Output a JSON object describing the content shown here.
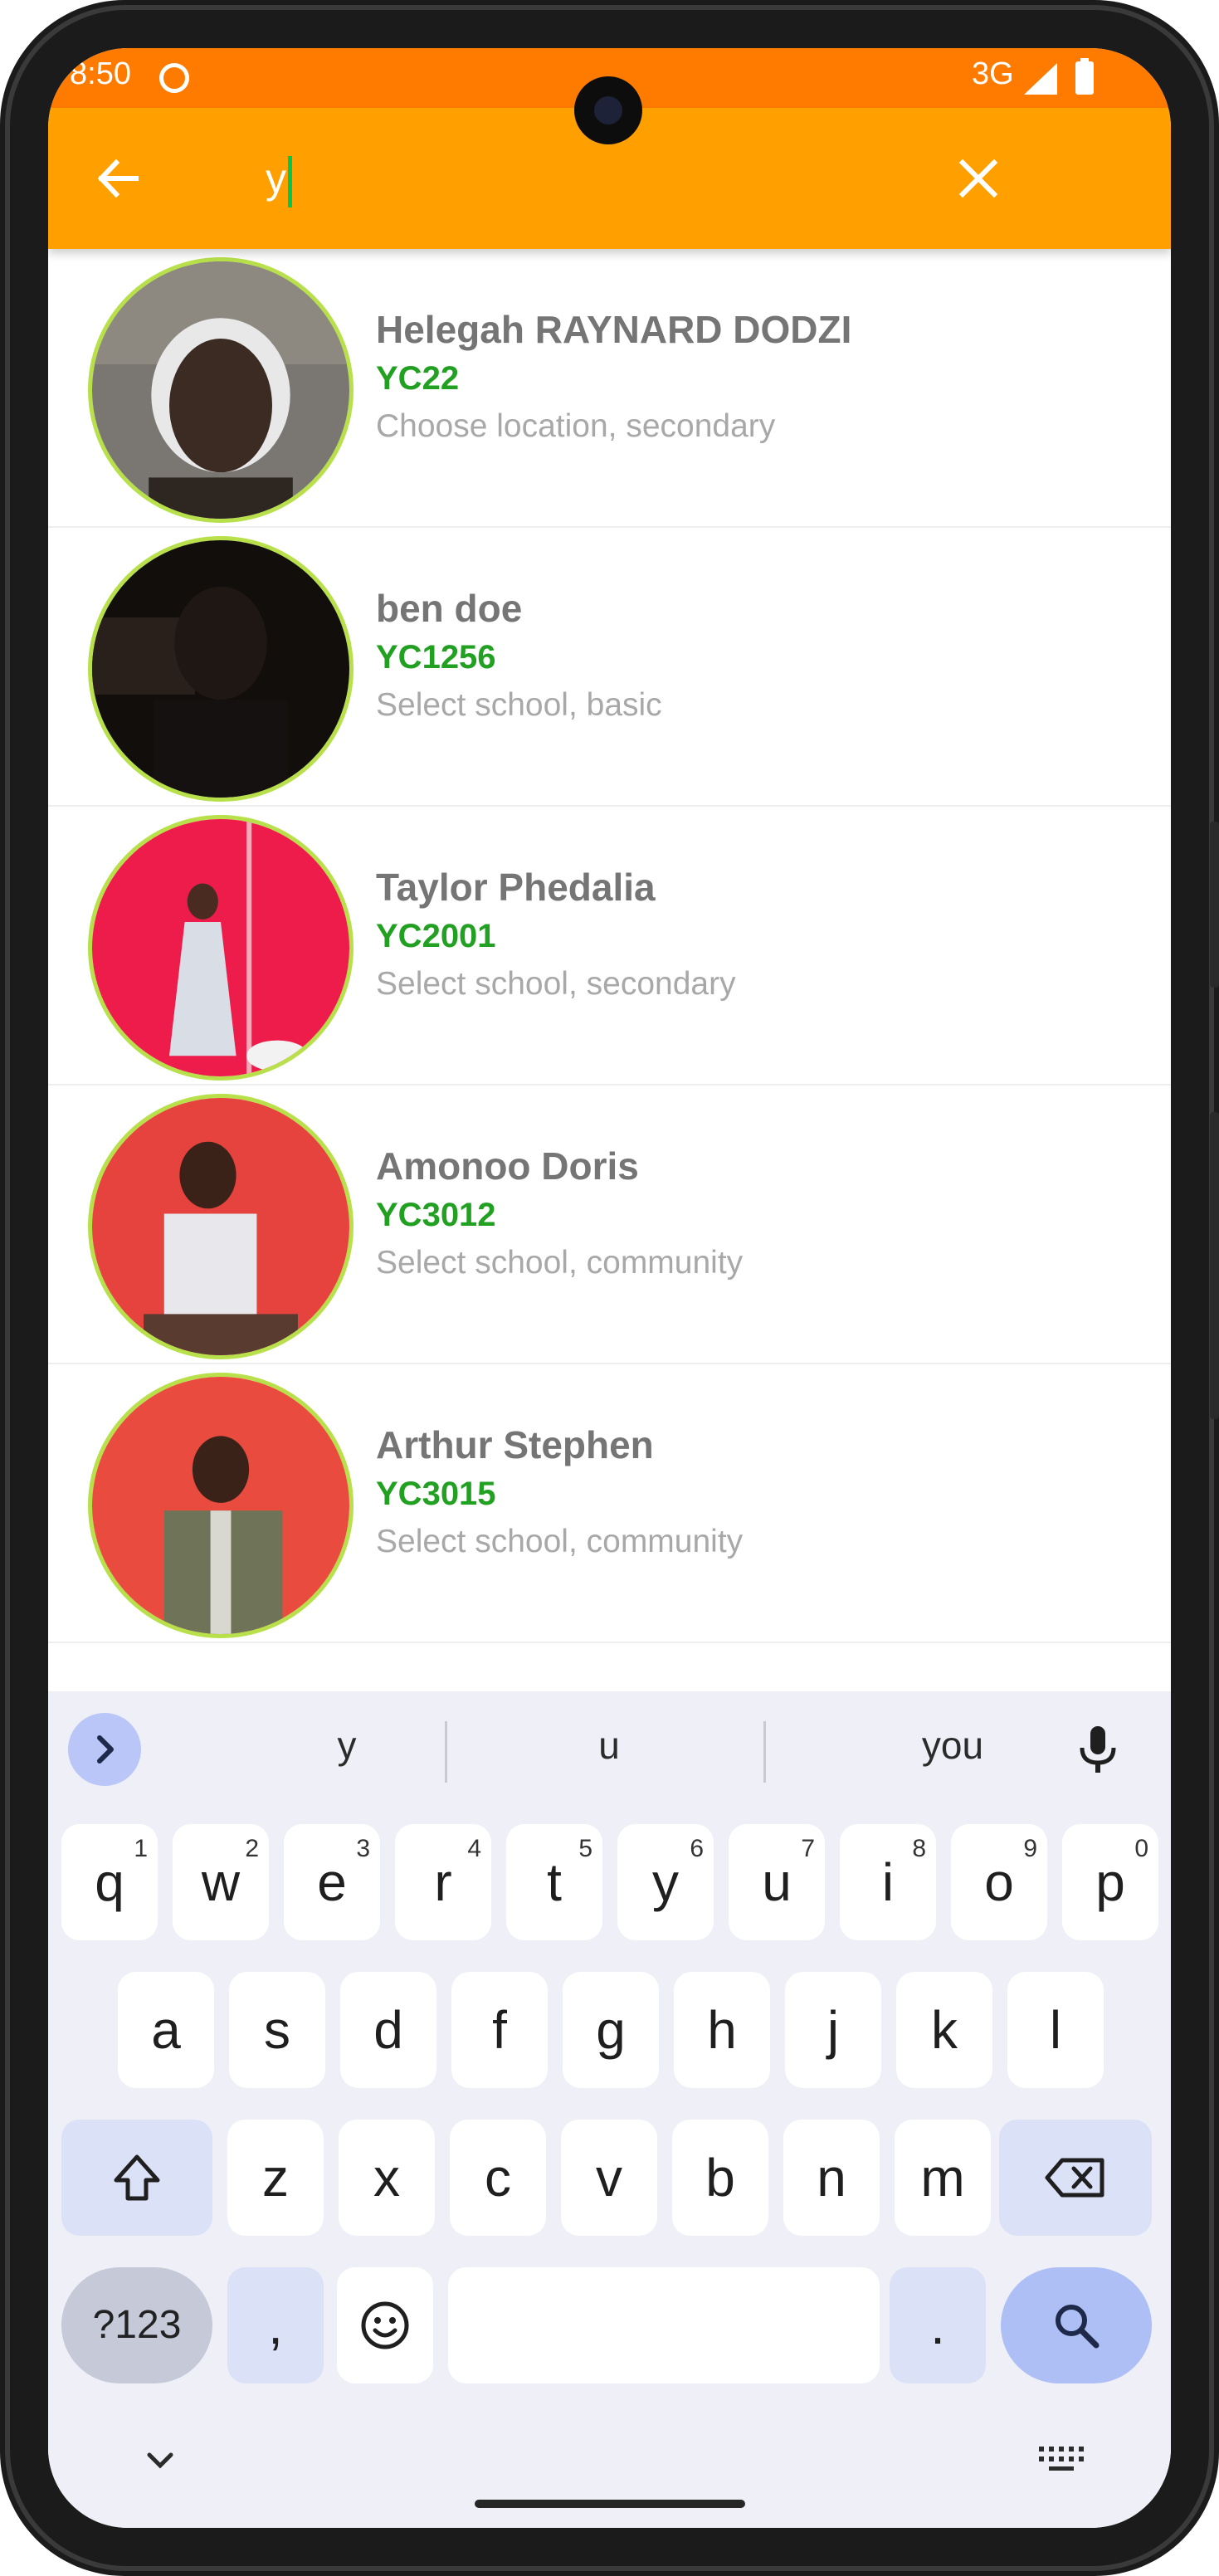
{
  "status_bar": {
    "time": "8:50",
    "network": "3G"
  },
  "search": {
    "query": "y"
  },
  "contacts": [
    {
      "name": "Helegah RAYNARD DODZI",
      "code": "YC22",
      "detail": "Choose location, secondary"
    },
    {
      "name": "ben doe",
      "code": "YC1256",
      "detail": "Select school, basic"
    },
    {
      "name": "Taylor Phedalia",
      "code": "YC2001",
      "detail": "Select school, secondary"
    },
    {
      "name": "Amonoo Doris",
      "code": "YC3012",
      "detail": "Select school, community"
    },
    {
      "name": "Arthur Stephen",
      "code": "YC3015",
      "detail": "Select school, community"
    }
  ],
  "keyboard": {
    "suggestions": [
      "y",
      "u",
      "you"
    ],
    "row1": [
      {
        "key": "q",
        "hint": "1"
      },
      {
        "key": "w",
        "hint": "2"
      },
      {
        "key": "e",
        "hint": "3"
      },
      {
        "key": "r",
        "hint": "4"
      },
      {
        "key": "t",
        "hint": "5"
      },
      {
        "key": "y",
        "hint": "6"
      },
      {
        "key": "u",
        "hint": "7"
      },
      {
        "key": "i",
        "hint": "8"
      },
      {
        "key": "o",
        "hint": "9"
      },
      {
        "key": "p",
        "hint": "0"
      }
    ],
    "row2": [
      "a",
      "s",
      "d",
      "f",
      "g",
      "h",
      "j",
      "k",
      "l"
    ],
    "row3": [
      "z",
      "x",
      "c",
      "v",
      "b",
      "n",
      "m"
    ],
    "symbols_label": "?123",
    "comma": ",",
    "period": "."
  },
  "colors": {
    "status_bar": "#ff7b00",
    "app_bar": "#ffa000",
    "code_green": "#22a022",
    "avatar_ring": "#b8e04a",
    "keyboard_bg": "#eff0f7"
  }
}
